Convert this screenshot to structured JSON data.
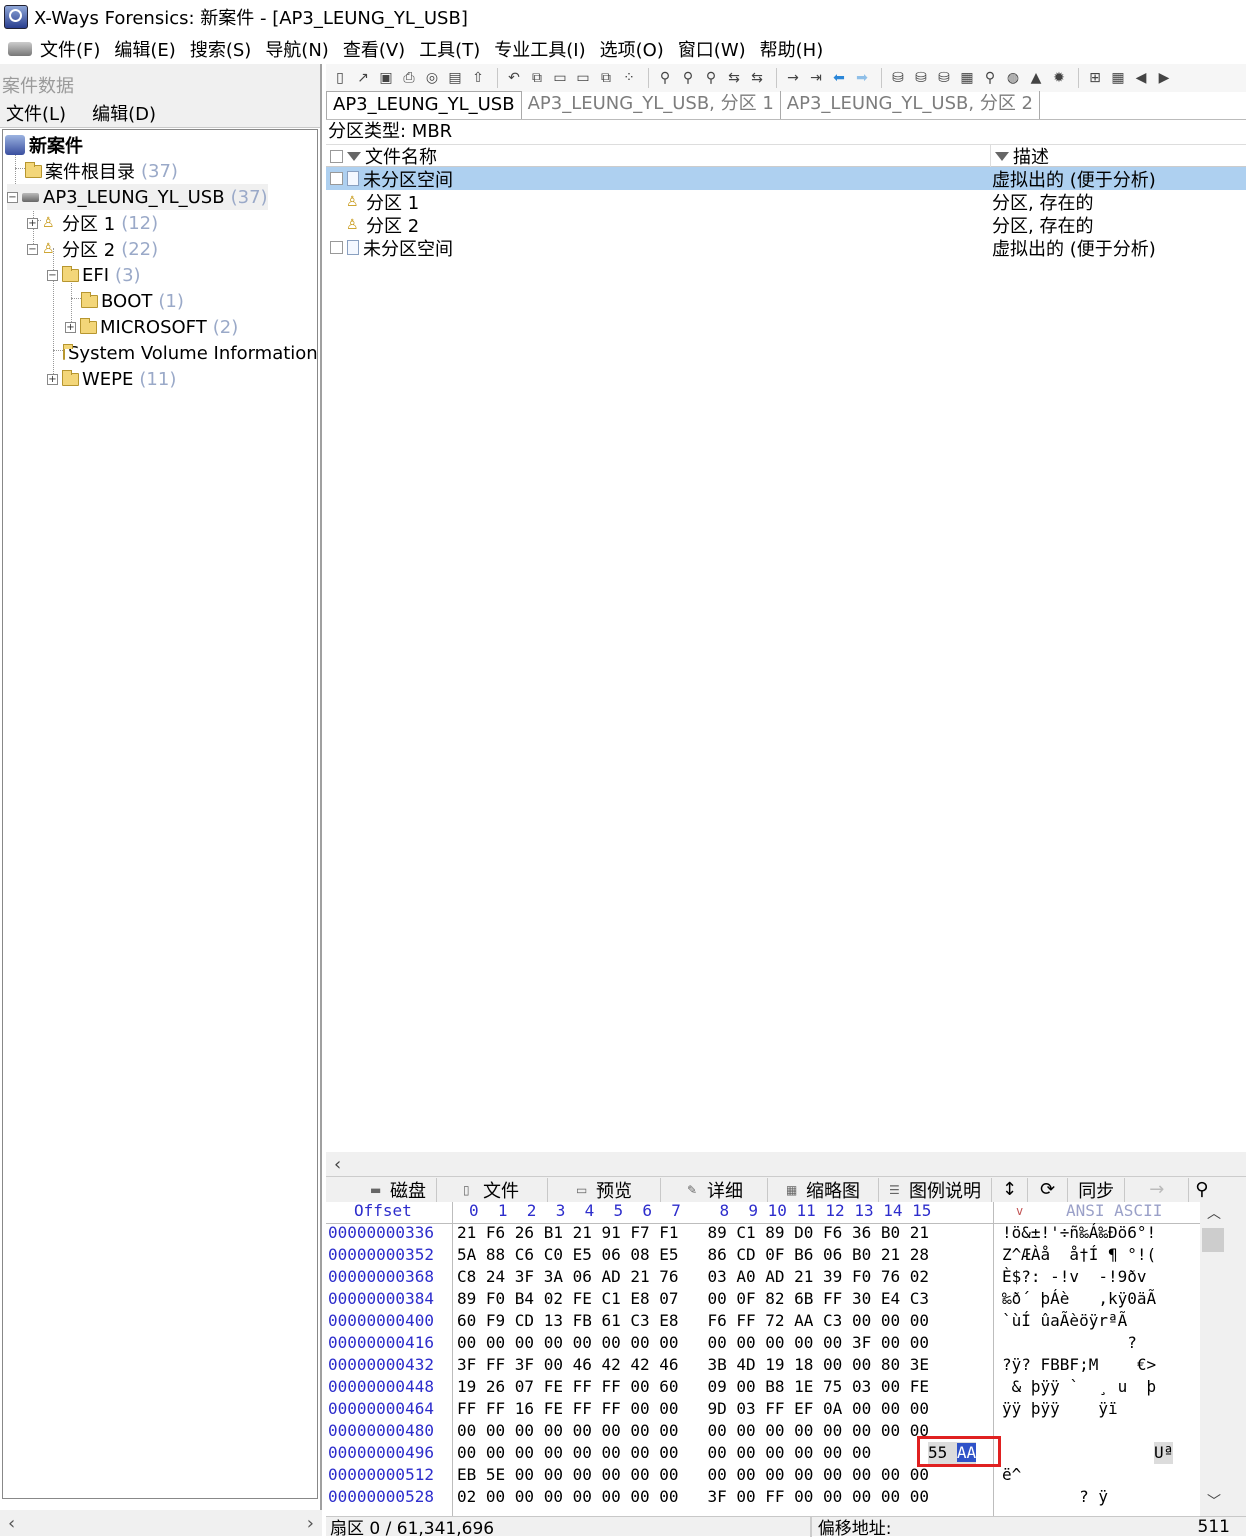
{
  "window": {
    "title": "X-Ways Forensics: 新案件 - [AP3_LEUNG_YL_USB]"
  },
  "menu": [
    "文件(F)",
    "编辑(E)",
    "搜索(S)",
    "导航(N)",
    "查看(V)",
    "工具(T)",
    "专业工具(I)",
    "选项(O)",
    "窗口(W)",
    "帮助(H)"
  ],
  "case_panel": {
    "header": "案件数据",
    "menu": [
      "文件(L)",
      "编辑(D)"
    ],
    "tree": {
      "root": "新案件",
      "root_dir": {
        "label": "案件根目录",
        "count": "(37)"
      },
      "disk": {
        "label": "AP3_LEUNG_YL_USB",
        "count": "(37)"
      },
      "part1": {
        "label": "分区 1",
        "count": "(12)"
      },
      "part2": {
        "label": "分区 2",
        "count": "(22)"
      },
      "efi": {
        "label": "EFI",
        "count": "(3)"
      },
      "boot": {
        "label": "BOOT",
        "count": "(1)"
      },
      "microsoft": {
        "label": "MICROSOFT",
        "count": "(2)"
      },
      "svi": {
        "label": "System Volume Information"
      },
      "wepe": {
        "label": "WEPE",
        "count": "(11)"
      }
    }
  },
  "tabs": [
    "AP3_LEUNG_YL_USB",
    "AP3_LEUNG_YL_USB, 分区 1",
    "AP3_LEUNG_YL_USB, 分区 2"
  ],
  "partition_type": "分区类型: MBR",
  "file_list": {
    "columns": [
      "文件名称",
      "描述"
    ],
    "rows": [
      {
        "name": "未分区空间",
        "desc": "虚拟出的 (便于分析)"
      },
      {
        "name": "分区 1",
        "desc": "分区, 存在的"
      },
      {
        "name": "分区 2",
        "desc": "分区, 存在的"
      },
      {
        "name": "未分区空间",
        "desc": "虚拟出的 (便于分析)"
      }
    ]
  },
  "bottom_tabs": [
    "磁盘",
    "文件",
    "预览",
    "详细",
    "缩略图",
    "图例说明",
    "同步"
  ],
  "hex_view": {
    "offset_header": "Offset",
    "col_headers": "0  1  2  3  4  5  6  7    8  9 10 11 12 13 14 15",
    "ascii_header": "ANSI ASCII",
    "rows": [
      {
        "offset": "00000000336",
        "hex": "21 F6 26 B1 21 91 F7 F1   89 C1 89 D0 F6 36 B0 21",
        "ascii": "!ö&±!'÷ñ‰Á‰Ðö6°!"
      },
      {
        "offset": "00000000352",
        "hex": "5A 88 C6 C0 E5 06 08 E5   86 CD 0F B6 06 B0 21 28",
        "ascii": "Z^ÆÀå  å†Í ¶ °!("
      },
      {
        "offset": "00000000368",
        "hex": "C8 24 3F 3A 06 AD 21 76   03 A0 AD 21 39 F0 76 02",
        "ascii": "È$?: -!v  -!9ðv"
      },
      {
        "offset": "00000000384",
        "hex": "89 F0 B4 02 FE C1 E8 07   00 0F 82 6B FF 30 E4 C3",
        "ascii": "‰ð´ þÁè   ,kÿ0äÃ"
      },
      {
        "offset": "00000000400",
        "hex": "60 F9 CD 13 FB 61 C3 E8   F6 FF 72 AA C3 00 00 00",
        "ascii": "`ùÍ ûaÃèöÿrªÃ"
      },
      {
        "offset": "00000000416",
        "hex": "00 00 00 00 00 00 00 00   00 00 00 00 00 3F 00 00",
        "ascii": "             ?"
      },
      {
        "offset": "00000000432",
        "hex": "3F FF 3F 00 46 42 42 46   3B 4D 19 18 00 00 80 3E",
        "ascii": "?ÿ? FBBF;M    €>"
      },
      {
        "offset": "00000000448",
        "hex": "19 26 07 FE FF FF 00 60   09 00 B8 1E 75 03 00 FE",
        "ascii": " & þÿÿ `  ¸ u  þ"
      },
      {
        "offset": "00000000464",
        "hex": "FF FF 16 FE FF FF 00 00   9D 03 FF EF 0A 00 00 00",
        "ascii": "ÿÿ þÿÿ    ÿï"
      },
      {
        "offset": "00000000480",
        "hex": "00 00 00 00 00 00 00 00   00 00 00 00 00 00 00 00",
        "ascii": ""
      },
      {
        "offset": "00000000496",
        "hex": "00 00 00 00 00 00 00 00   00 00 00 00 00 00",
        "ascii": ""
      },
      {
        "offset": "00000000512",
        "hex": "EB 5E 00 00 00 00 00 00   00 00 00 00 00 00 00 00",
        "ascii": "ë^"
      },
      {
        "offset": "00000000528",
        "hex": "02 00 00 00 00 00 00 00   3F 00 FF 00 00 00 00 00",
        "ascii": "        ? ÿ"
      }
    ],
    "sig_bytes": "55",
    "sig_byte_sel": "AA",
    "sig_ascii": "Uª"
  },
  "status": {
    "sector": "扇区 0 / 61,341,696",
    "offset_label": "偏移地址:",
    "offset_value": "511"
  }
}
